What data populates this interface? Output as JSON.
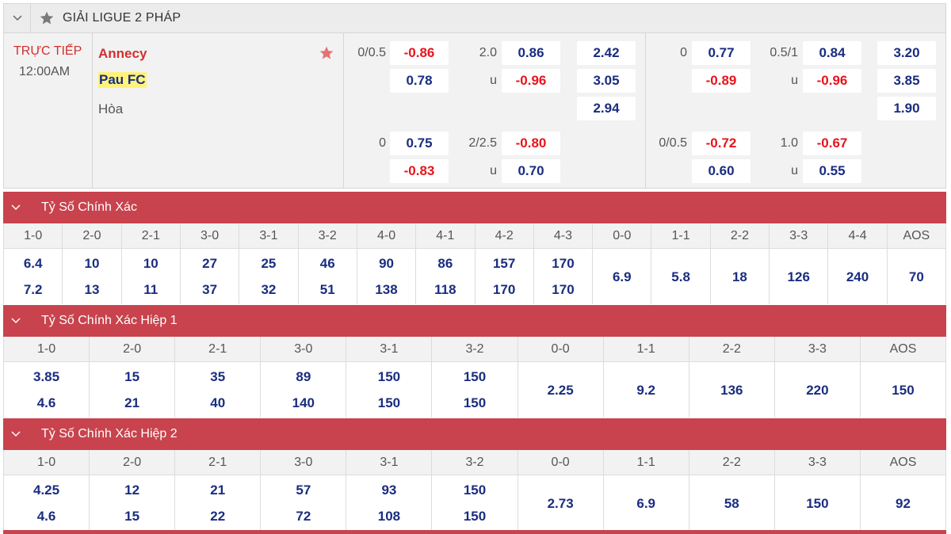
{
  "league": {
    "name": "GIẢI LIGUE 2 PHÁP"
  },
  "match": {
    "status": "TRỰC TIẾP",
    "time": "12:00AM",
    "home": "Annecy",
    "away": "Pau FC",
    "draw": "Hòa"
  },
  "odds": {
    "ft": {
      "hdp1": {
        "line": "0/0.5",
        "home": "-0.86",
        "away": "0.78"
      },
      "ou1": {
        "line": "2.0",
        "over": "0.86",
        "u": "u",
        "under": "-0.96"
      },
      "x12": {
        "home": "2.42",
        "away": "3.05",
        "draw": "2.94"
      },
      "hdp2": {
        "line": "0",
        "home": "0.75",
        "away": "-0.83"
      },
      "ou2": {
        "line": "2/2.5",
        "over": "-0.80",
        "u": "u",
        "under": "0.70"
      }
    },
    "h1": {
      "hdp1": {
        "line": "0",
        "home": "0.77",
        "away": "-0.89"
      },
      "ou1": {
        "line": "0.5/1",
        "over": "0.84",
        "u": "u",
        "under": "-0.96"
      },
      "x12": {
        "home": "3.20",
        "away": "3.85",
        "draw": "1.90"
      },
      "hdp2": {
        "line": "0/0.5",
        "home": "-0.72",
        "away": "0.60"
      },
      "ou2": {
        "line": "1.0",
        "over": "-0.67",
        "u": "u",
        "under": "0.55"
      }
    }
  },
  "sections": [
    {
      "title": "Tỷ Số Chính Xác",
      "columns": [
        "1-0",
        "2-0",
        "2-1",
        "3-0",
        "3-1",
        "3-2",
        "4-0",
        "4-1",
        "4-2",
        "4-3",
        "0-0",
        "1-1",
        "2-2",
        "3-3",
        "4-4",
        "AOS"
      ],
      "top": [
        "6.4",
        "10",
        "10",
        "27",
        "25",
        "46",
        "90",
        "86",
        "157",
        "170",
        "6.9",
        "5.8",
        "18",
        "126",
        "240",
        "70"
      ],
      "bottom": [
        "7.2",
        "13",
        "11",
        "37",
        "32",
        "51",
        "138",
        "118",
        "170",
        "170",
        "",
        "",
        "",
        "",
        "",
        ""
      ]
    },
    {
      "title": "Tỷ Số Chính Xác Hiệp 1",
      "columns": [
        "1-0",
        "2-0",
        "2-1",
        "3-0",
        "3-1",
        "3-2",
        "0-0",
        "1-1",
        "2-2",
        "3-3",
        "AOS"
      ],
      "top": [
        "3.85",
        "15",
        "35",
        "89",
        "150",
        "150",
        "2.25",
        "9.2",
        "136",
        "220",
        "150"
      ],
      "bottom": [
        "4.6",
        "21",
        "40",
        "140",
        "150",
        "150",
        "",
        "",
        "",
        "",
        ""
      ]
    },
    {
      "title": "Tỷ Số Chính Xác Hiệp 2",
      "columns": [
        "1-0",
        "2-0",
        "2-1",
        "3-0",
        "3-1",
        "3-2",
        "0-0",
        "1-1",
        "2-2",
        "3-3",
        "AOS"
      ],
      "top": [
        "4.25",
        "12",
        "21",
        "57",
        "93",
        "150",
        "2.73",
        "6.9",
        "58",
        "150",
        "92"
      ],
      "bottom": [
        "4.6",
        "15",
        "22",
        "72",
        "108",
        "150",
        "",
        "",
        "",
        "",
        ""
      ]
    }
  ],
  "colors": {
    "accent": "#c8434d",
    "positive": "#1a2d80",
    "negative": "#e8141c",
    "highlight": "#fff27a"
  }
}
